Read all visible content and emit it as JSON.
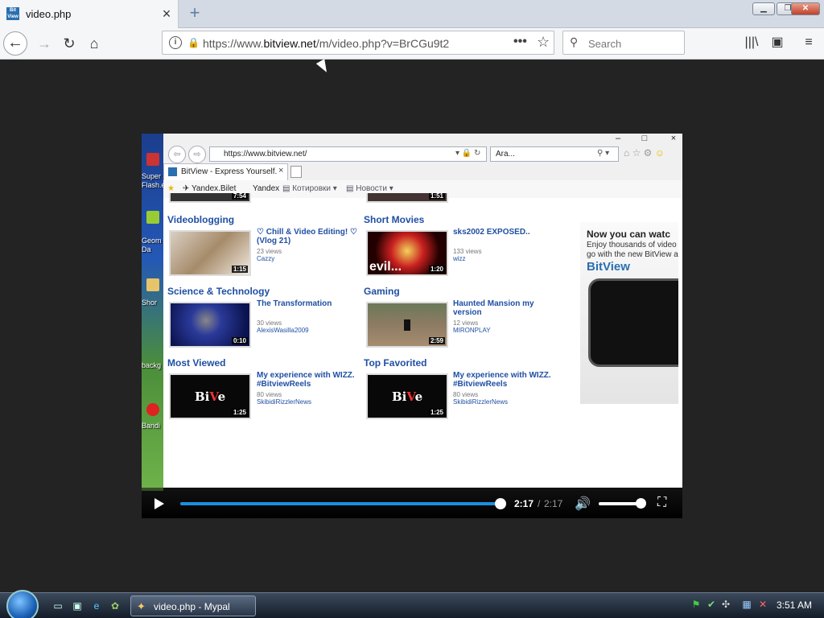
{
  "browser": {
    "tab_title": "video.php",
    "tab_favicon_text": "Bit View",
    "url_prefix": "https://www.",
    "url_domain": "bitview.net",
    "url_path": "/m/video.php?v=BrCGu9t2",
    "search_placeholder": "Search",
    "icons": [
      "back-icon",
      "forward-icon",
      "reload-icon",
      "home-icon",
      "info-icon",
      "lock-icon",
      "more-icon",
      "bookmark-star-icon",
      "search-icon",
      "library-icon",
      "sidebar-icon",
      "menu-icon"
    ]
  },
  "desktop_strip": {
    "labels": [
      "Super S",
      "Flash.e",
      "Geom",
      "Da",
      "Shor",
      "backg",
      "Bandi"
    ]
  },
  "ie": {
    "address": "https://www.bitview.net/",
    "search_text": "Ara...",
    "tab_title": "BitView - Express Yourself.",
    "favorites": [
      "Yandex.Bilet",
      "Yandex",
      "Котировки",
      "Новости"
    ]
  },
  "content": {
    "top_partial_durations": [
      "7:54",
      "1:51"
    ],
    "sections": [
      {
        "title": "Videoblogging",
        "video": {
          "title": "♡ Chill & Video Editing! ♡ (Vlog 21)",
          "views": "23 views",
          "user": "Cazzy",
          "duration": "1:15"
        }
      },
      {
        "title": "Short Movies",
        "video": {
          "title": "sks2002 EXPOSED..",
          "views": "133 views",
          "user": "wizz",
          "duration": "1:20"
        }
      },
      {
        "title": "Science & Technology",
        "video": {
          "title": "The Transformation",
          "views": "30 views",
          "user": "AlexisWasilla2009",
          "duration": "0:10"
        }
      },
      {
        "title": "Gaming",
        "video": {
          "title": "Haunted Mansion my version",
          "views": "12 views",
          "user": "MIRONPLAY",
          "duration": "2:59"
        }
      },
      {
        "title": "Most Viewed",
        "video": {
          "title": "My experience with WIZZ. #BitviewReels",
          "views": "80 views",
          "user": "SkibidiRizzlerNews",
          "duration": "1:25"
        }
      },
      {
        "title": "Top Favorited",
        "video": {
          "title": "My experience with WIZZ. #BitviewReels",
          "views": "80 views",
          "user": "SkibidiRizzlerNews",
          "duration": "1:25"
        }
      }
    ],
    "ad": {
      "headline": "Now you can watc",
      "sub": "Enjoy thousands of video\ngo with the new BitView a",
      "logo": "BitView"
    }
  },
  "player": {
    "current_time": "2:17",
    "separator": "/",
    "total_time": "2:17",
    "progress_fraction": 1.0,
    "volume_fraction": 1.0,
    "accent_color": "#1b8fe0"
  },
  "taskbar": {
    "task_label": "video.php - Mypal",
    "clock": "3:51 AM"
  }
}
